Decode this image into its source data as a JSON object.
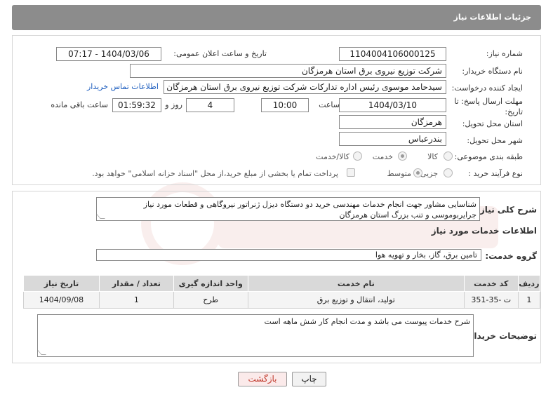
{
  "header": {
    "title": "جزئیات اطلاعات نیاز"
  },
  "form": {
    "need_number_label": "شماره نیاز:",
    "need_number": "1104004106000125",
    "announce_label": "تاریخ و ساعت اعلان عمومی:",
    "announce_value": "1404/03/06 - 07:17",
    "buyer_org_label": "نام دستگاه خریدار:",
    "buyer_org": "شرکت توزیع نیروی برق استان هرمزگان",
    "creator_label": "ایجاد کننده درخواست:",
    "creator": "سیدحامد موسوی رئیس اداره تدارکات شرکت توزیع نیروی برق استان هرمزگان",
    "contact_link": "اطلاعات تماس خریدار",
    "deadline_label_1": "مهلت ارسال پاسخ: تا",
    "deadline_label_2": "تاریخ:",
    "deadline_date": "1404/03/10",
    "time_label": "ساعت",
    "deadline_time": "10:00",
    "days_value": "4",
    "days_label": "روز و",
    "remaining_time": "01:59:32",
    "remaining_label": "ساعت باقی مانده",
    "province_label": "استان محل تحویل:",
    "province": "هرمزگان",
    "city_label": "شهر محل تحویل:",
    "city": "بندرعباس",
    "category_label": "طبقه بندی موضوعی:",
    "category_options": [
      "کالا",
      "خدمت",
      "کالا/خدمت"
    ],
    "category_selected": "خدمت",
    "process_label": "نوع فرآیند خرید :",
    "process_options": [
      "جزیی",
      "متوسط"
    ],
    "process_selected": "متوسط",
    "payment_note": "پرداخت تمام یا بخشی از مبلغ خرید،از محل \"اسناد خزانه اسلامی\" خواهد بود."
  },
  "details": {
    "summary_label": "شرح کلی نیاز:",
    "summary": "شناسایی مشاور جهت انجام خدمات مهندسی خرید دو دستگاه دیزل ژنراتور نیروگاهی و قطعات مورد نیاز جرایربوموسی و تنب بزرگ استان هرمزگان",
    "services_heading": "اطلاعات خدمات مورد نیاز",
    "service_group_label": "گروه خدمت:",
    "service_group": "تامین برق، گاز، بخار و تهویه هوا",
    "table": {
      "headers": [
        "ردیف",
        "کد خدمت",
        "نام خدمت",
        "واحد اندازه گیری",
        "تعداد / مقدار",
        "تاریخ نیاز"
      ],
      "rows": [
        [
          "1",
          "ت -35-351",
          "تولید، انتقال و توزیع برق",
          "طرح",
          "1",
          "1404/09/08"
        ]
      ]
    },
    "buyer_notes_label": "توضیحات خریدار:",
    "buyer_notes": "شرح خدمات پیوست می باشد و مدت انجام کار شش ماهه است"
  },
  "buttons": {
    "print": "چاپ",
    "back": "بازگشت"
  },
  "colors": {
    "title_bg": "#8c8c8c",
    "link": "#1f5fbf",
    "back_text": "#c0392b"
  }
}
